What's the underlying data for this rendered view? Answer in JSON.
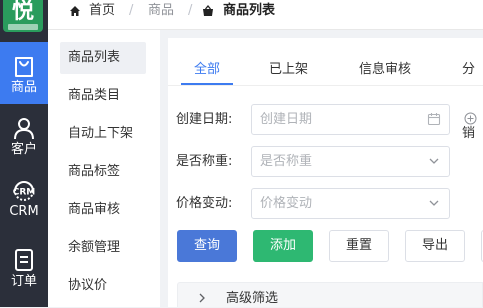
{
  "app": {
    "logo_char": "悦"
  },
  "rail": {
    "items": [
      {
        "label": "商品",
        "icon": "shopping-bag-icon",
        "active": true
      },
      {
        "label": "客户",
        "icon": "user-icon",
        "active": false
      },
      {
        "label": "CRM",
        "icon": "crm-icon",
        "badge": "CRM",
        "active": false
      },
      {
        "label": "订单",
        "icon": "order-document-icon",
        "active": false
      }
    ]
  },
  "breadcrumb": {
    "home": "首页",
    "sep": "/",
    "level2": "商品",
    "current": "商品列表"
  },
  "subnav": {
    "items": [
      "商品列表",
      "商品类目",
      "自动上下架",
      "商品标签",
      "商品审核",
      "余额管理",
      "协议价"
    ],
    "active_index": 0
  },
  "tabs": {
    "items": [
      "全部",
      "已上架",
      "信息审核",
      "分销"
    ],
    "active_index": 0
  },
  "filters": {
    "created_date": {
      "label": "创建日期:",
      "placeholder": "创建日期"
    },
    "weigh": {
      "label": "是否称重:",
      "placeholder": "是否称重"
    },
    "price_change": {
      "label": "价格变动:",
      "placeholder": "价格变动"
    }
  },
  "actions": {
    "query": "查询",
    "add": "添加",
    "reset": "重置",
    "export": "导出"
  },
  "advanced": {
    "label": "高级筛选"
  },
  "colors": {
    "accent": "#3d7bf0",
    "primary_button": "#4a78d8",
    "success_button": "#2eb872",
    "rail_bg": "#2b2f3a",
    "logo_bg": "#2a9c5d"
  }
}
